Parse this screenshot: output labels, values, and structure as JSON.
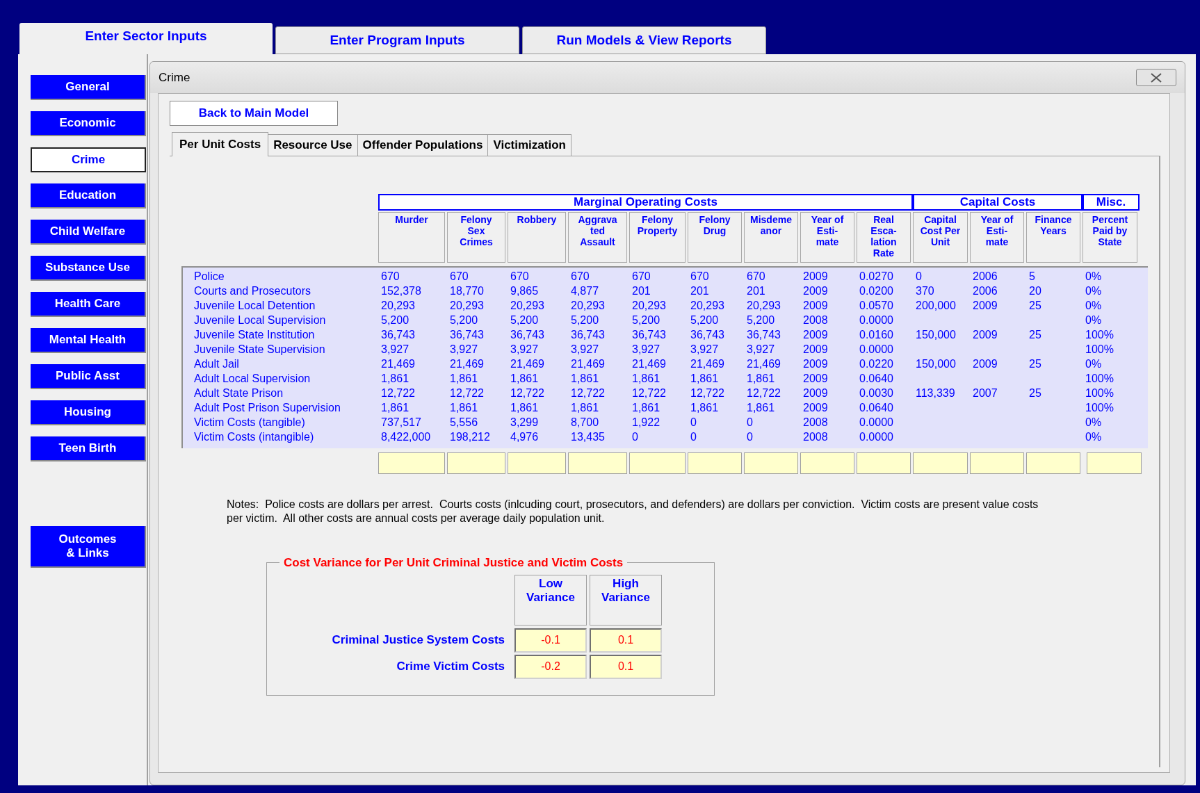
{
  "main_tabs": [
    {
      "label": "Enter Sector Inputs",
      "selected": true
    },
    {
      "label": "Enter Program Inputs",
      "selected": false
    },
    {
      "label": "Run Models & View Reports",
      "selected": false
    }
  ],
  "sidebar": {
    "items": [
      {
        "label": "General",
        "selected": false
      },
      {
        "label": "Economic",
        "selected": false
      },
      {
        "label": "Crime",
        "selected": true
      },
      {
        "label": "Education",
        "selected": false
      },
      {
        "label": "Child Welfare",
        "selected": false
      },
      {
        "label": "Substance Use",
        "selected": false
      },
      {
        "label": "Health Care",
        "selected": false
      },
      {
        "label": "Mental Health",
        "selected": false
      },
      {
        "label": "Public Asst",
        "selected": false
      },
      {
        "label": "Housing",
        "selected": false
      },
      {
        "label": "Teen Birth",
        "selected": false
      }
    ],
    "footer_button": "Outcomes\n& Links"
  },
  "dialog": {
    "title": "Crime",
    "back_button": "Back to Main Model",
    "tabs": [
      {
        "label": "Per Unit Costs",
        "selected": true
      },
      {
        "label": "Resource Use",
        "selected": false
      },
      {
        "label": "Offender Populations",
        "selected": false
      },
      {
        "label": "Victimization",
        "selected": false
      }
    ],
    "table": {
      "groups": [
        {
          "label": "Marginal Operating Costs",
          "columns": [
            "Murder",
            "Felony\nSex\nCrimes",
            "Robbery",
            "Aggrava\nted\nAssault",
            "Felony\nProperty",
            "Felony\nDrug",
            "Misdeme\nanor",
            "Year of\nEsti-\nmate",
            "Real\nEsca-\nlation\nRate"
          ]
        },
        {
          "label": "Capital Costs",
          "columns": [
            "Capital\nCost Per\nUnit",
            "Year of\nEsti-\nmate",
            "Finance\nYears"
          ]
        },
        {
          "label": "Misc.",
          "columns": [
            "Percent\nPaid by\nState"
          ]
        }
      ],
      "rows": [
        {
          "label": "Police",
          "cells": [
            "670",
            "670",
            "670",
            "670",
            "670",
            "670",
            "670",
            "2009",
            "0.0270",
            "0",
            "2006",
            "5",
            "0%"
          ]
        },
        {
          "label": "Courts and Prosecutors",
          "cells": [
            "152,378",
            "18,770",
            "9,865",
            "4,877",
            "201",
            "201",
            "201",
            "2009",
            "0.0200",
            "370",
            "2006",
            "20",
            "0%"
          ]
        },
        {
          "label": "Juvenile Local Detention",
          "cells": [
            "20,293",
            "20,293",
            "20,293",
            "20,293",
            "20,293",
            "20,293",
            "20,293",
            "2009",
            "0.0570",
            "200,000",
            "2009",
            "25",
            "0%"
          ]
        },
        {
          "label": "Juvenile Local Supervision",
          "cells": [
            "5,200",
            "5,200",
            "5,200",
            "5,200",
            "5,200",
            "5,200",
            "5,200",
            "2008",
            "0.0000",
            null,
            null,
            null,
            "0%"
          ]
        },
        {
          "label": "Juvenile State Institution",
          "cells": [
            "36,743",
            "36,743",
            "36,743",
            "36,743",
            "36,743",
            "36,743",
            "36,743",
            "2009",
            "0.0160",
            "150,000",
            "2009",
            "25",
            "100%"
          ]
        },
        {
          "label": "Juvenile State Supervision",
          "cells": [
            "3,927",
            "3,927",
            "3,927",
            "3,927",
            "3,927",
            "3,927",
            "3,927",
            "2009",
            "0.0000",
            null,
            null,
            null,
            "100%"
          ]
        },
        {
          "label": "Adult Jail",
          "cells": [
            "21,469",
            "21,469",
            "21,469",
            "21,469",
            "21,469",
            "21,469",
            "21,469",
            "2009",
            "0.0220",
            "150,000",
            "2009",
            "25",
            "0%"
          ]
        },
        {
          "label": "Adult Local Supervision",
          "cells": [
            "1,861",
            "1,861",
            "1,861",
            "1,861",
            "1,861",
            "1,861",
            "1,861",
            "2009",
            "0.0640",
            null,
            null,
            null,
            "100%"
          ]
        },
        {
          "label": "Adult State Prison",
          "cells": [
            "12,722",
            "12,722",
            "12,722",
            "12,722",
            "12,722",
            "12,722",
            "12,722",
            "2009",
            "0.0030",
            "113,339",
            "2007",
            "25",
            "100%"
          ]
        },
        {
          "label": "Adult Post Prison Supervision",
          "cells": [
            "1,861",
            "1,861",
            "1,861",
            "1,861",
            "1,861",
            "1,861",
            "1,861",
            "2009",
            "0.0640",
            null,
            null,
            null,
            "100%"
          ]
        },
        {
          "label": "Victim Costs (tangible)",
          "cells": [
            "737,517",
            "5,556",
            "3,299",
            "8,700",
            "1,922",
            "0",
            "0",
            "2008",
            "0.0000",
            null,
            null,
            null,
            "0%"
          ]
        },
        {
          "label": "Victim Costs (intangible)",
          "cells": [
            "8,422,000",
            "198,212",
            "4,976",
            "13,435",
            "0",
            "0",
            "0",
            "2008",
            "0.0000",
            null,
            null,
            null,
            "0%"
          ]
        }
      ]
    },
    "notes": "Notes:  Police costs are dollars per arrest.  Courts costs (inlcuding court, prosecutors, and defenders) are dollars per conviction.  Victim costs are present value costs per victim.  All other costs are annual costs per average daily population unit.",
    "variance": {
      "title": "Cost Variance for Per Unit Criminal Justice and Victim Costs",
      "columns": [
        "Low\nVariance",
        "High\nVariance"
      ],
      "rows": [
        {
          "label": "Criminal Justice System Costs",
          "low": "-0.1",
          "high": "0.1"
        },
        {
          "label": "Crime Victim Costs",
          "low": "-0.2",
          "high": "0.1"
        }
      ]
    }
  }
}
